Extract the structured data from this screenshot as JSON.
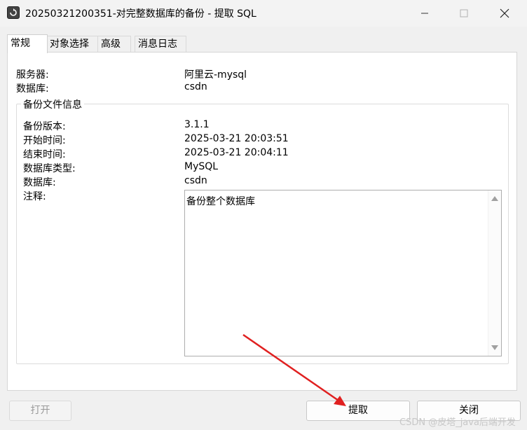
{
  "window": {
    "title": "20250321200351-对完整数据库的备份 - 提取 SQL"
  },
  "tabs": [
    {
      "label": "常规"
    },
    {
      "label": "对象选择"
    },
    {
      "label": "高级"
    },
    {
      "label": "消息日志"
    }
  ],
  "general": {
    "server_label": "服务器:",
    "server_value": "阿里云-mysql",
    "database_label": "数据库:",
    "database_value": "csdn"
  },
  "backup_info": {
    "group_title": "备份文件信息",
    "version_label": "备份版本:",
    "version_value": "3.1.1",
    "start_label": "开始时间:",
    "start_value": "2025-03-21 20:03:51",
    "end_label": "结束时间:",
    "end_value": "2025-03-21 20:04:11",
    "db_type_label": "数据库类型:",
    "db_type_value": "MySQL",
    "database_label": "数据库:",
    "database_value": "csdn",
    "notes_label": "注释:",
    "notes_value": "备份整个数据库"
  },
  "buttons": {
    "open": "打开",
    "extract": "提取",
    "close": "关闭"
  },
  "colors": {
    "annotation_arrow": "#e02020"
  },
  "watermark": "CSDN @皮塔_java后端开发"
}
